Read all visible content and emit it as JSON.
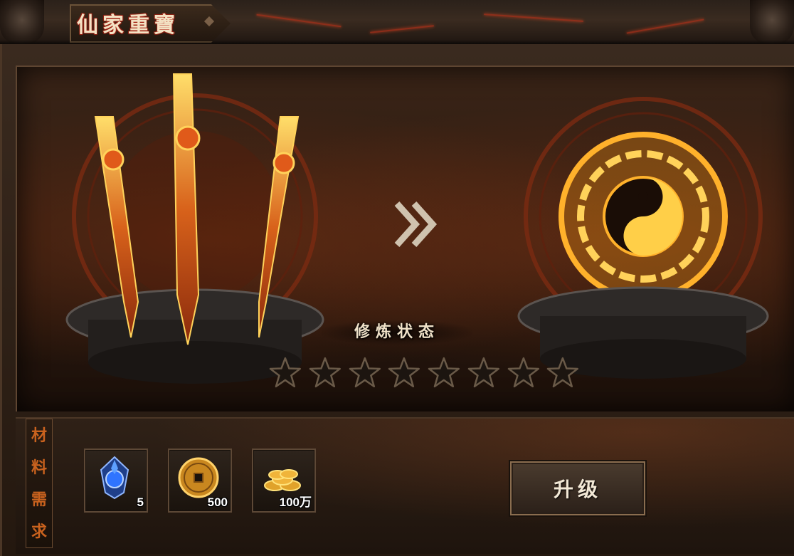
{
  "window": {
    "title": "仙家重寶"
  },
  "stage": {
    "left_artifact": "three-swords-icon",
    "right_artifact": "bagua-taiji-icon",
    "arrow": "double-chevron-right-icon",
    "status_label": "修炼状态",
    "stars": {
      "total": 8,
      "filled": 0
    }
  },
  "requirements": {
    "label_chars": [
      "材",
      "料",
      "需",
      "求"
    ],
    "items": [
      {
        "icon": "blue-crystal-icon",
        "count": "5"
      },
      {
        "icon": "copper-coin-icon",
        "count": "500"
      },
      {
        "icon": "gold-coins-pile-icon",
        "count": "100万"
      }
    ]
  },
  "actions": {
    "upgrade_label": "升级"
  },
  "colors": {
    "accent_orange": "#c9621e",
    "title_red": "#c2301f",
    "panel_dark": "#1a120c"
  }
}
